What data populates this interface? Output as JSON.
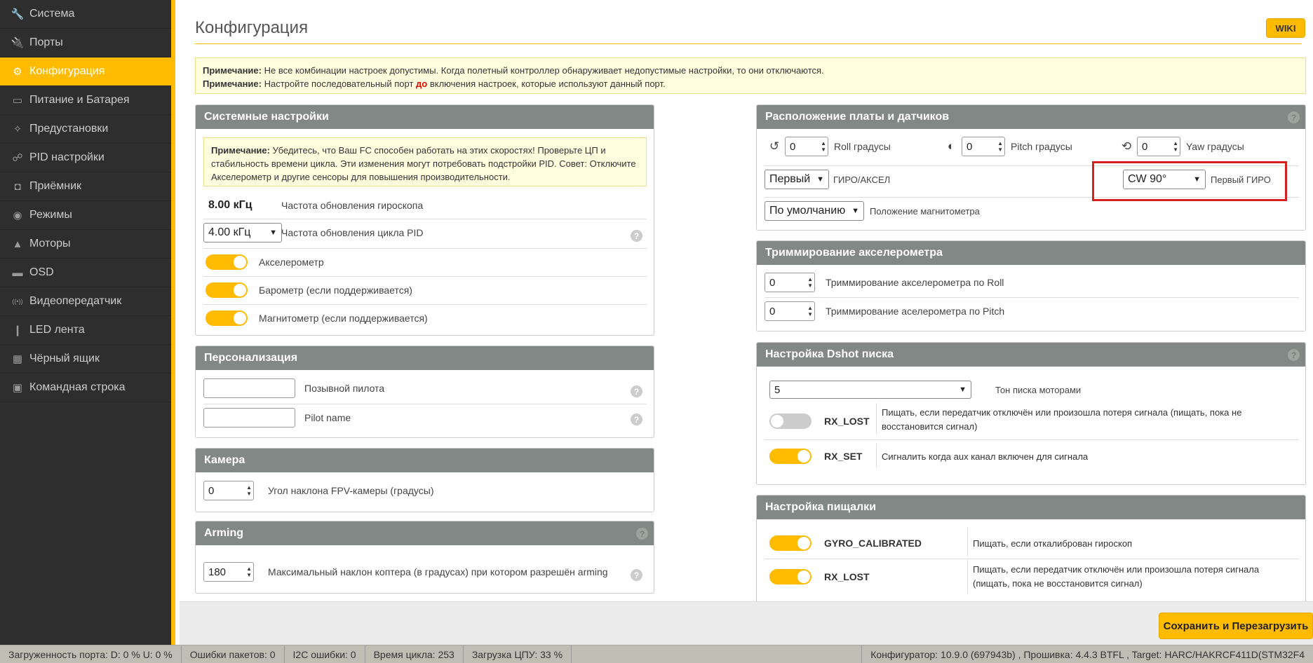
{
  "sidebar": {
    "items": [
      {
        "label": "Система",
        "icon": "wrench-icon",
        "glyph": "🔧"
      },
      {
        "label": "Порты",
        "icon": "plug-icon",
        "glyph": "🔌"
      },
      {
        "label": "Конфигурация",
        "icon": "gear-icon",
        "glyph": "⚙"
      },
      {
        "label": "Питание и Батарея",
        "icon": "battery-icon",
        "glyph": "▭"
      },
      {
        "label": "Предустановки",
        "icon": "magic-wand-icon",
        "glyph": "✧"
      },
      {
        "label": "PID настройки",
        "icon": "sitemap-icon",
        "glyph": "☍"
      },
      {
        "label": "Приёмник",
        "icon": "robot-icon",
        "glyph": "◘"
      },
      {
        "label": "Режимы",
        "icon": "toggle-icon",
        "glyph": "◉"
      },
      {
        "label": "Моторы",
        "icon": "motor-icon",
        "glyph": "▲"
      },
      {
        "label": "OSD",
        "icon": "osd-icon",
        "glyph": "▬"
      },
      {
        "label": "Видеопередатчик",
        "icon": "broadcast-icon",
        "glyph": "((•))"
      },
      {
        "label": "LED лента",
        "icon": "led-icon",
        "glyph": "❙"
      },
      {
        "label": "Чёрный ящик",
        "icon": "blackbox-icon",
        "glyph": "▦"
      },
      {
        "label": "Командная строка",
        "icon": "terminal-icon",
        "glyph": "▣"
      }
    ],
    "active_index": 2
  },
  "header": {
    "title": "Конфигурация",
    "wiki": "WIKI"
  },
  "note": {
    "label": "Примечание:",
    "line1": "Не все комбинации настроек допустимы. Когда полетный контроллер обнаруживает недопустимые настройки, то они отключаются.",
    "line2_a": "Настройте последовательный порт",
    "line2_b": "до",
    "line2_c": "включения настроек, которые используют данный порт."
  },
  "system": {
    "title": "Системные настройки",
    "note_label": "Примечание:",
    "note_text": "Убедитесь, что Ваш FC способен работать на этих скоростях! Проверьте ЦП и стабильность времени цикла. Эти изменения могут потребовать подстройки PID. Совет: Отключите Акселерометр и другие сенсоры для повышения производительности.",
    "gyro_rate": "8.00 кГц",
    "gyro_rate_label": "Частота обновления гироскопа",
    "pid_rate": "4.00 кГц",
    "pid_rate_label": "Частота обновления цикла PID",
    "accel": "Акселерометр",
    "baro": "Барометр (если поддерживается)",
    "mag": "Магнитометр (если поддерживается)"
  },
  "personal": {
    "title": "Персонализация",
    "callsign": "Позывной пилота",
    "pilot_name": "Pilot name"
  },
  "camera": {
    "title": "Камера",
    "angle": "0",
    "angle_label": "Угол наклона FPV-камеры (градусы)"
  },
  "arming": {
    "title": "Arming",
    "angle": "180",
    "angle_label": "Максимальный наклон коптера (в градусах) при котором разрешён arming"
  },
  "board": {
    "title": "Расположение платы и датчиков",
    "roll": "0",
    "roll_label": "Roll градусы",
    "pitch": "0",
    "pitch_label": "Pitch градусы",
    "yaw": "0",
    "yaw_label": "Yaw градусы",
    "gyro_sel": "Первый",
    "gyro_label": "ГИРО/АКСЕЛ",
    "align_sel": "CW 90°",
    "align_label": "Первый ГИРО",
    "mag_sel": "По умолчанию",
    "mag_label": "Положение магнитометра"
  },
  "trim": {
    "title": "Триммирование акселерометра",
    "roll": "0",
    "roll_label": "Триммирование акселерометра по Roll",
    "pitch": "0",
    "pitch_label": "Триммирование аселерометра по Pitch"
  },
  "dshot": {
    "title": "Настройка Dshot писка",
    "tone": "5",
    "tone_label": "Тон писка моторами",
    "rx_lost": "RX_LOST",
    "rx_lost_desc": "Пищать, если передатчик отключён или произошла потеря сигнала (пищать, пока не восстановится сигнал)",
    "rx_set": "RX_SET",
    "rx_set_desc": "Сигналить когда aux канал включен для сигнала"
  },
  "beeper": {
    "title": "Настройка пищалки",
    "gyro_cal": "GYRO_CALIBRATED",
    "gyro_cal_desc": "Пищать, если откалиброван гироскоп",
    "rx_lost": "RX_LOST",
    "rx_lost_desc": "Пищать, если передатчик отключён или произошла потеря сигнала (пищать, пока не восстановится сигнал)"
  },
  "footer": {
    "save": "Сохранить и Перезагрузить"
  },
  "status": {
    "port": "Загруженность порта: D: 0 % U: 0 %",
    "packet_errors": "Ошибки пакетов: 0",
    "i2c": "I2C ошибки: 0",
    "cycle": "Время цикла: 253",
    "cpu": "Загрузка ЦПУ: 33 %",
    "version": "Конфигуратор: 10.9.0 (697943b) , Прошивка: 4.4.3 BTFL , Target: HARC/HAKRCF411D(STM32F4"
  },
  "colors": {
    "accent": "#ffbb00",
    "sidebar": "#2e2e2e",
    "panel_header": "#828885",
    "highlight_box": "#d4201f"
  }
}
